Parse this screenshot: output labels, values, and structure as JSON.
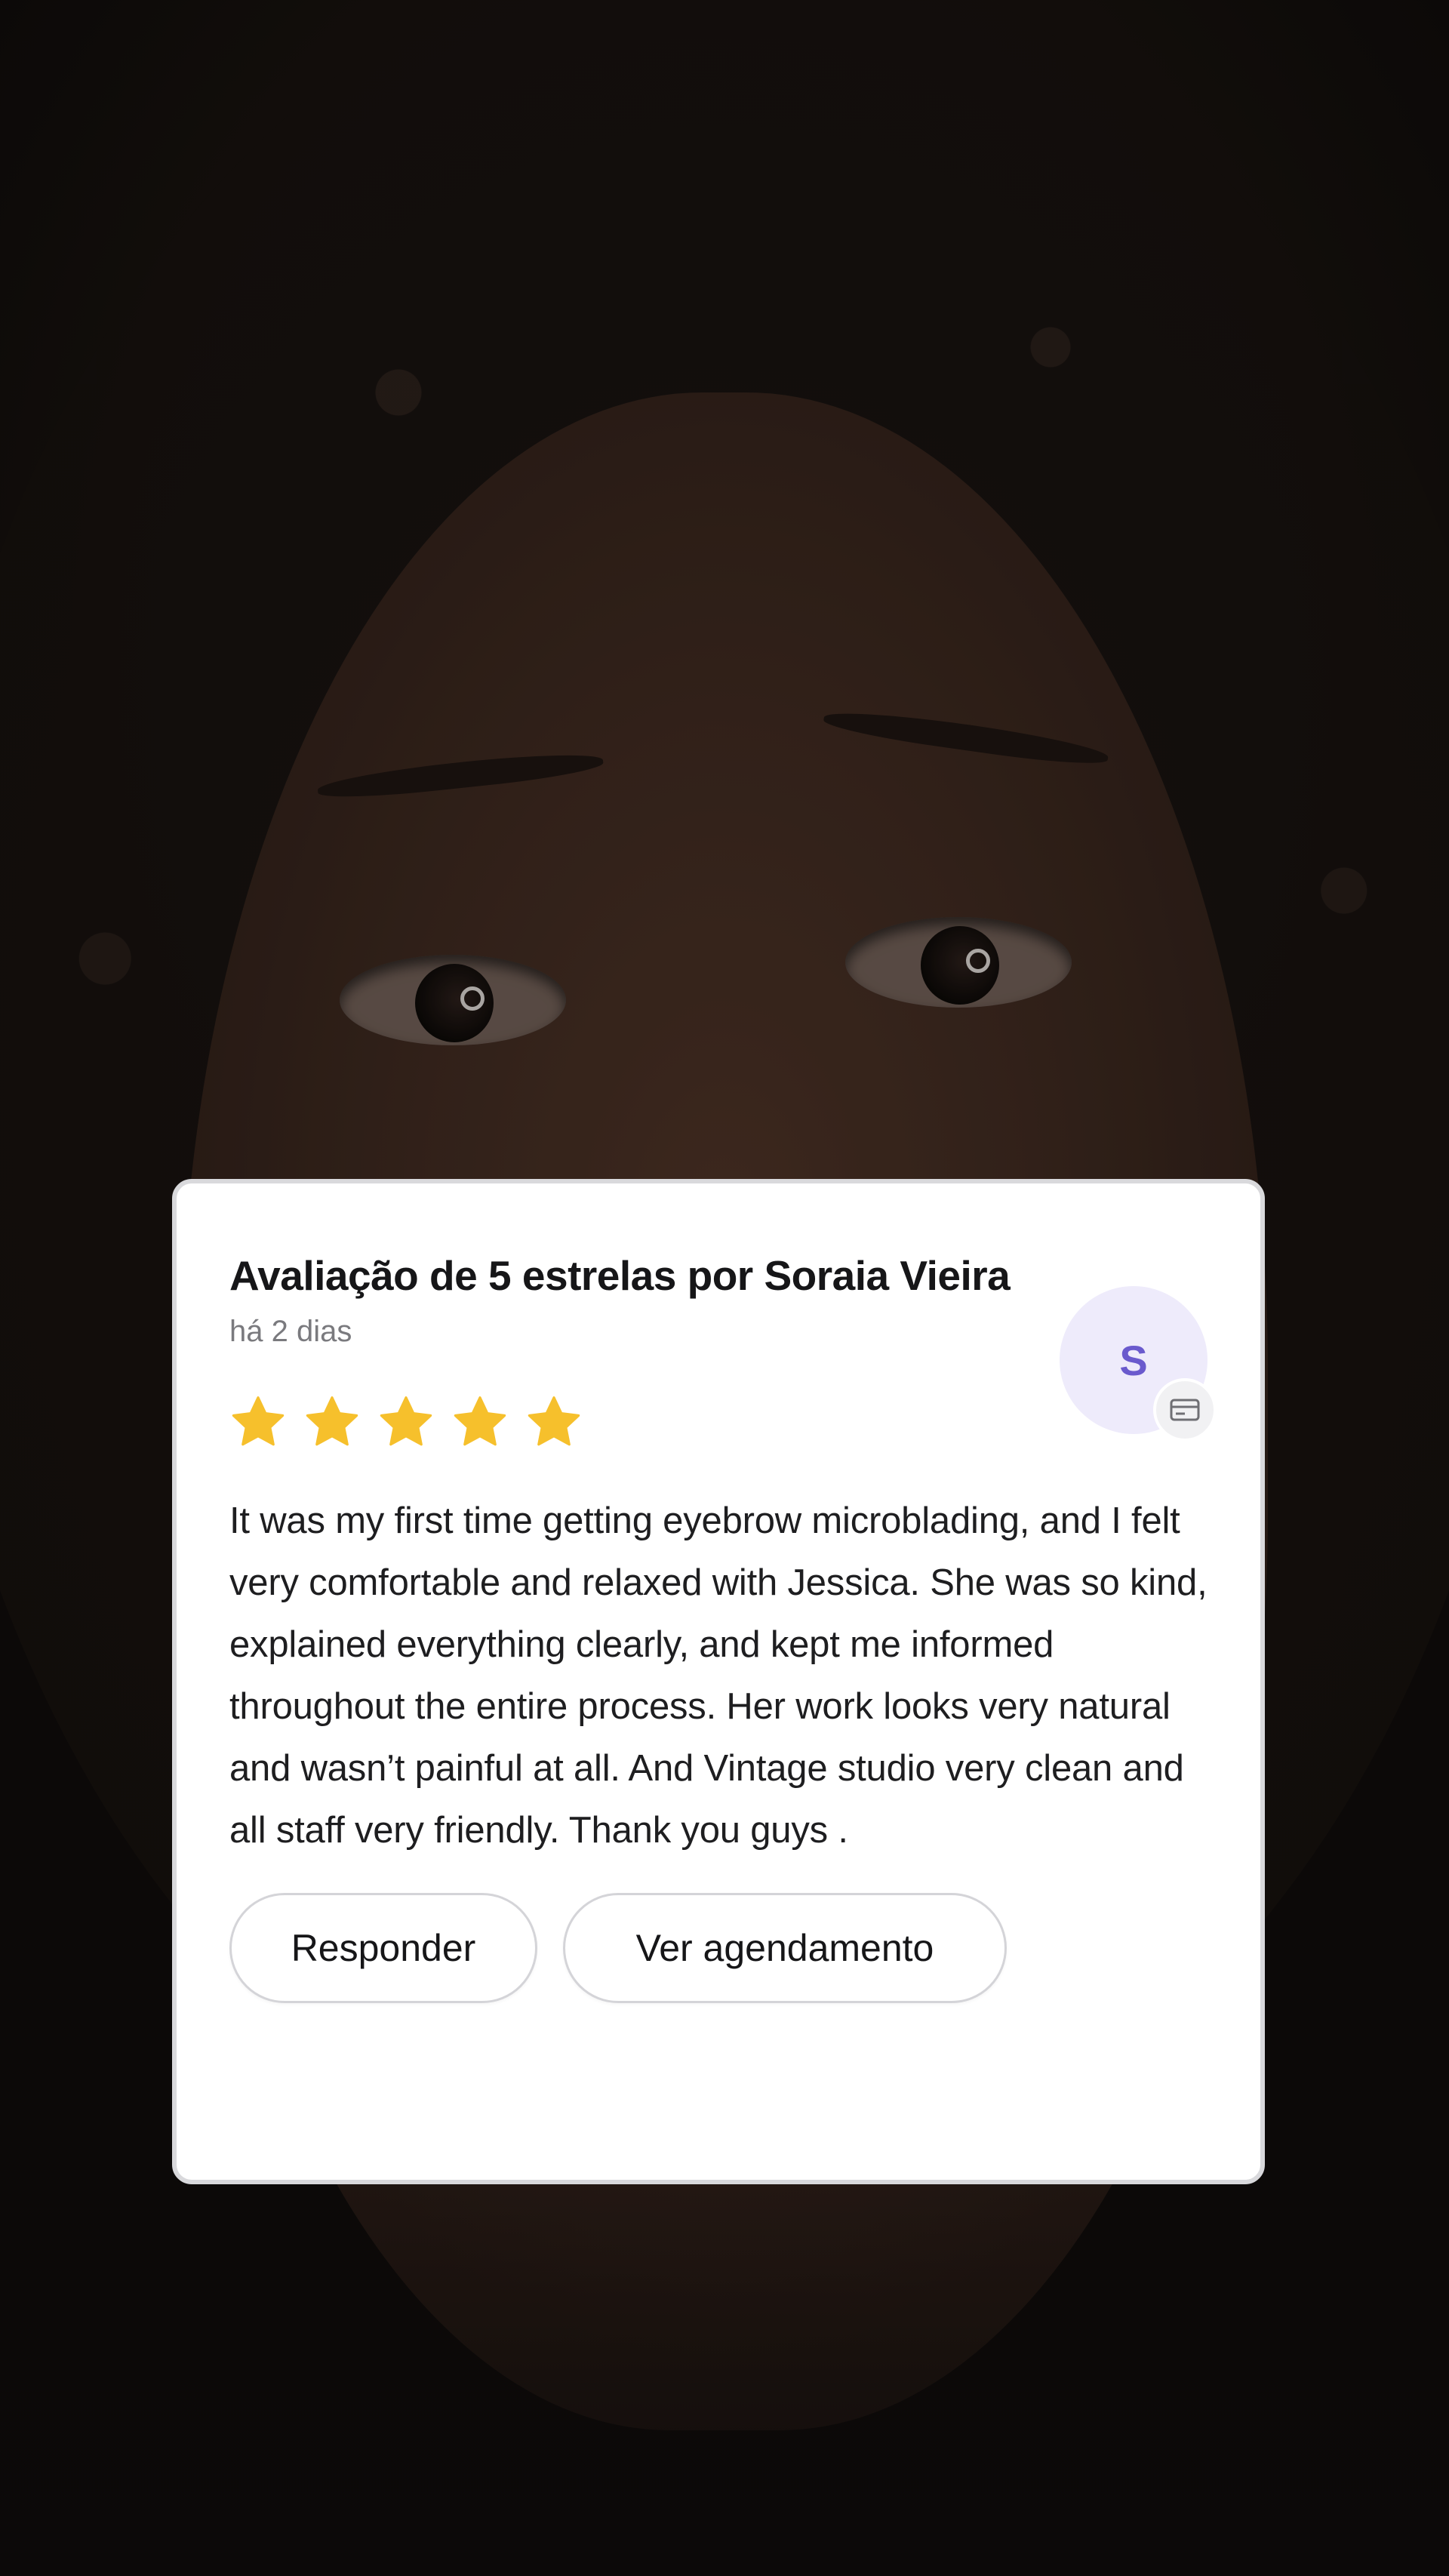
{
  "review": {
    "title": "Avaliação de 5 estrelas por Soraia Vieira",
    "timestamp": "há 2 dias",
    "rating": 5,
    "star_color": "#F6C02C",
    "text": "It was my first time getting eyebrow microblading, and I felt very comfortable and relaxed with Jessica. She was so kind, explained everything clearly, and kept me informed throughout the entire process. Her work looks very natural and wasn’t painful at all. And Vintage studio very clean and all staff very friendly. Thank you guys .",
    "avatar": {
      "initial": "S",
      "bg_color": "#EEEBFB",
      "initial_color": "#6A5ACD",
      "badge_icon": "card-icon"
    }
  },
  "actions": {
    "reply_label": "Responder",
    "view_booking_label": "Ver agendamento"
  }
}
